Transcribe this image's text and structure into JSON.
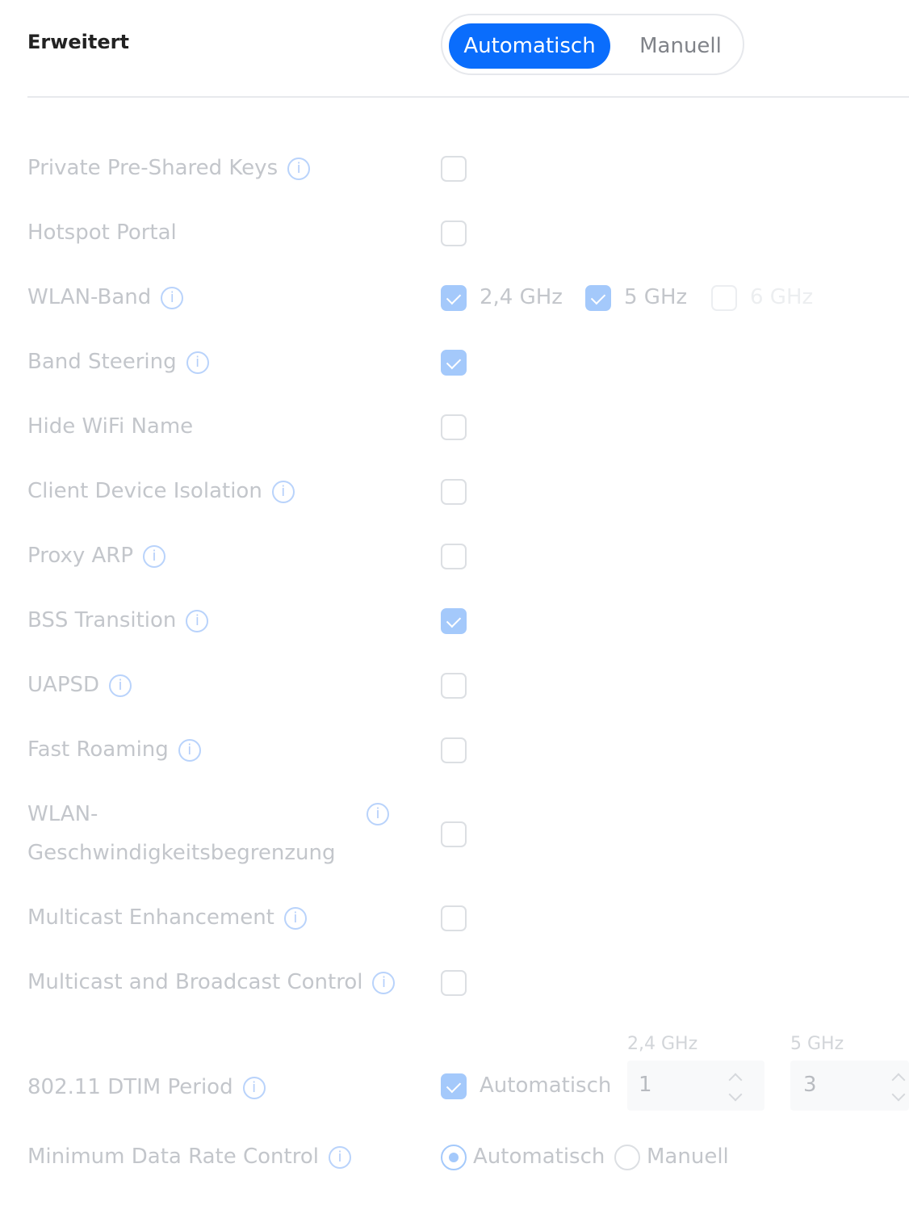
{
  "section": {
    "title": "Erweitert",
    "mode_toggle": {
      "active": "Automatisch",
      "inactive": "Manuell"
    }
  },
  "rows": [
    {
      "label": "Private Pre-Shared Keys",
      "checked": false
    },
    {
      "label": "Hotspot Portal",
      "checked": false
    },
    {
      "label": "WLAN-Band",
      "bands": [
        "2,4 GHz",
        "5 GHz",
        "6 GHz"
      ]
    },
    {
      "label": "Band Steering",
      "checked": true
    },
    {
      "label": "Hide WiFi Name",
      "checked": false
    },
    {
      "label": "Client Device Isolation",
      "checked": false
    },
    {
      "label": "Proxy ARP",
      "checked": false
    },
    {
      "label": "BSS Transition",
      "checked": true
    },
    {
      "label": "UAPSD",
      "checked": false
    },
    {
      "label": "Fast Roaming",
      "checked": false
    },
    {
      "label_line1": "WLAN-",
      "label_line2": "Geschwindigkeitsbegrenzung",
      "checked": false
    },
    {
      "label": "Multicast Enhancement",
      "checked": false
    },
    {
      "label": "Multicast and Broadcast Control",
      "checked": false
    }
  ],
  "band_state": {
    "2,4 GHz": true,
    "5 GHz": true,
    "6 GHz": false
  },
  "dtim": {
    "label": "802.11 DTIM Period",
    "auto_label": "Automatisch",
    "auto_checked": true,
    "col_24": "2,4 GHz",
    "col_5": "5 GHz",
    "value_24": "1",
    "value_5": "3"
  },
  "min_rate": {
    "label": "Minimum Data Rate Control",
    "option_auto": "Automatisch",
    "option_manual": "Manuell",
    "selected": "Automatisch"
  },
  "info_icon_glyph": "i",
  "colors": {
    "accent": "#0a6dfc",
    "disabled_accent": "#a4c9fb",
    "label_disabled": "#c3c6cb"
  }
}
